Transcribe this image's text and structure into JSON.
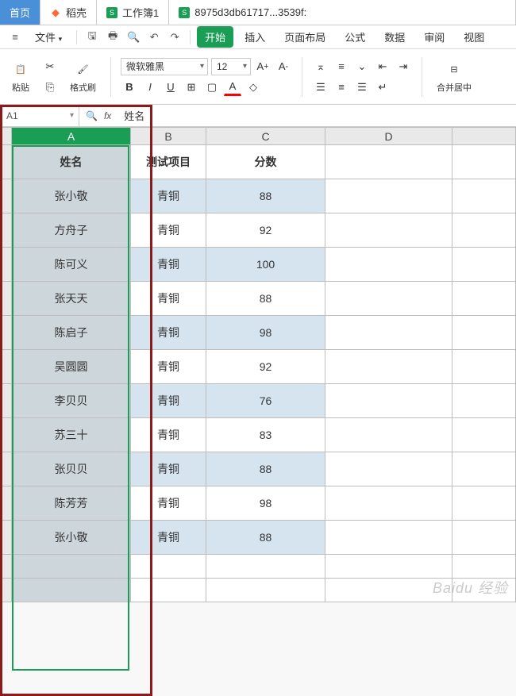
{
  "tabs": [
    {
      "label": "首页",
      "icon_color": "#fff"
    },
    {
      "label": "稻壳",
      "icon_color": "#ff6b35"
    },
    {
      "label": "工作簿1",
      "icon_color": "#1a9e55"
    },
    {
      "label": "8975d3db61717...3539f:",
      "icon_color": "#1a9e55"
    }
  ],
  "menubar": {
    "file": "文件",
    "items": [
      "开始",
      "插入",
      "页面布局",
      "公式",
      "数据",
      "审阅",
      "视图"
    ]
  },
  "ribbon": {
    "paste": "粘贴",
    "format_painter": "格式刷",
    "font_name": "微软雅黑",
    "font_size": "12",
    "merge_center": "合并居中"
  },
  "formula_bar": {
    "name_box": "A1",
    "value": "姓名"
  },
  "columns": [
    "A",
    "B",
    "C",
    "D"
  ],
  "headers": {
    "a": "姓名",
    "b": "测试项目",
    "c": "分数"
  },
  "rows": [
    {
      "a": "张小敬",
      "b": "青铜",
      "c": "88"
    },
    {
      "a": "方舟子",
      "b": "青铜",
      "c": "92"
    },
    {
      "a": "陈可义",
      "b": "青铜",
      "c": "100"
    },
    {
      "a": "张天天",
      "b": "青铜",
      "c": "88"
    },
    {
      "a": "陈启子",
      "b": "青铜",
      "c": "98"
    },
    {
      "a": "吴圆圆",
      "b": "青铜",
      "c": "92"
    },
    {
      "a": "李贝贝",
      "b": "青铜",
      "c": "76"
    },
    {
      "a": "苏三十",
      "b": "青铜",
      "c": "83"
    },
    {
      "a": "张贝贝",
      "b": "青铜",
      "c": "88"
    },
    {
      "a": "陈芳芳",
      "b": "青铜",
      "c": "98"
    },
    {
      "a": "张小敬",
      "b": "青铜",
      "c": "88"
    }
  ],
  "watermark": "Baidu 经验"
}
